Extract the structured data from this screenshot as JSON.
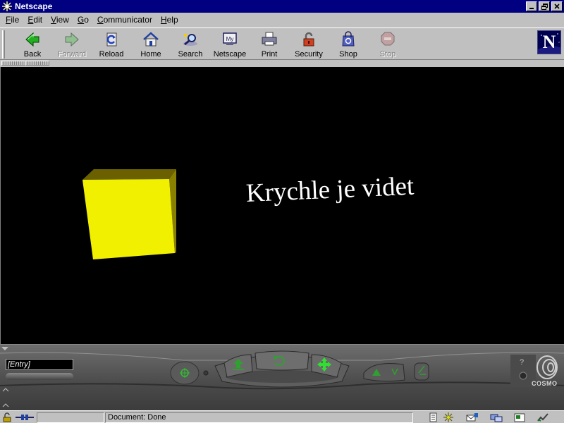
{
  "window": {
    "title": "Netscape"
  },
  "menu": [
    {
      "label": "File",
      "ul": "F",
      "rest": "ile"
    },
    {
      "label": "Edit",
      "ul": "E",
      "rest": "dit"
    },
    {
      "label": "View",
      "ul": "V",
      "rest": "iew"
    },
    {
      "label": "Go",
      "ul": "G",
      "rest": "o"
    },
    {
      "label": "Communicator",
      "ul": "C",
      "rest": "ommunicator"
    },
    {
      "label": "Help",
      "ul": "H",
      "rest": "elp"
    }
  ],
  "toolbar": {
    "back": "Back",
    "forward": "Forward",
    "reload": "Reload",
    "home": "Home",
    "search": "Search",
    "netscape": "Netscape",
    "print": "Print",
    "security": "Security",
    "shop": "Shop",
    "stop": "Stop"
  },
  "logo": {
    "letter": "N"
  },
  "scene": {
    "text": "Krychle je videt",
    "cube_color": "#f0f000",
    "background": "#000000"
  },
  "dashboard": {
    "viewpoint": "[Entry]",
    "brand": "COSMO"
  },
  "status": {
    "text": "Document: Done"
  },
  "colors": {
    "titlebar": "#000080",
    "chrome": "#c0c0c0",
    "nav_green": "#20c020"
  }
}
